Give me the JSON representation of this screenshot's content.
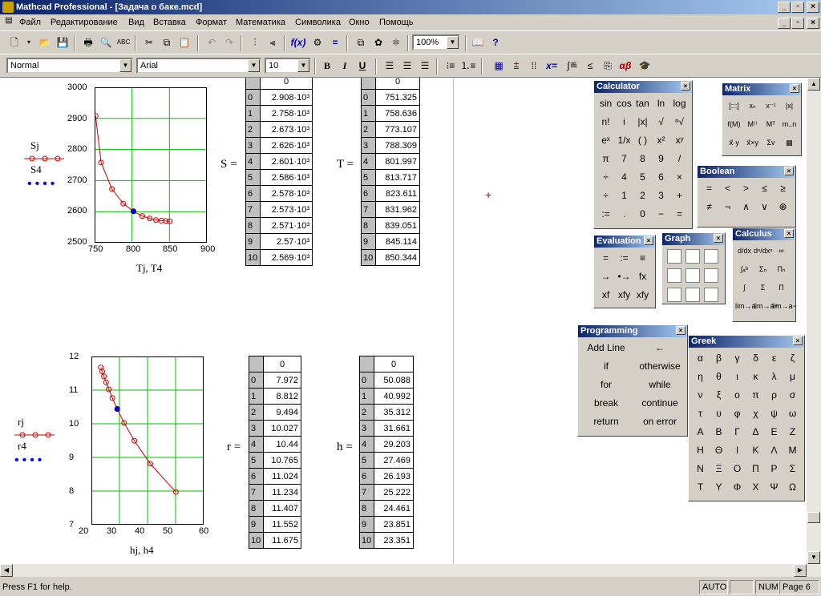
{
  "window": {
    "title": "Mathcad Professional - [Задача о баке.mcd]"
  },
  "menu": [
    "Файл",
    "Редактирование",
    "Вид",
    "Вставка",
    "Формат",
    "Математика",
    "Символика",
    "Окно",
    "Помощь"
  ],
  "toolbar": {
    "zoom": "100%"
  },
  "format_bar": {
    "style": "Normal",
    "font": "Arial",
    "size": "10"
  },
  "status": {
    "help": "Press F1 for help.",
    "mode": "AUTO",
    "num": "NUM",
    "page": "Page 6"
  },
  "plot1": {
    "legend": [
      "Sj",
      "S4"
    ],
    "xlabel": "Tj, T4",
    "xticks": [
      "750",
      "800",
      "850",
      "900"
    ],
    "yticks": [
      "3000",
      "2900",
      "2800",
      "2700",
      "2600",
      "2500"
    ]
  },
  "plot2": {
    "legend": [
      "rj",
      "r4"
    ],
    "xlabel": "hj, h4",
    "xticks": [
      "20",
      "30",
      "40",
      "50",
      "60"
    ],
    "yticks": [
      "12",
      "11",
      "10",
      "9",
      "8",
      "7"
    ]
  },
  "chart_data": [
    {
      "type": "line",
      "title": "",
      "xlabel": "Tj, T4",
      "ylabel": "",
      "xlim": [
        750,
        900
      ],
      "ylim": [
        2500,
        3000
      ],
      "series": [
        {
          "name": "Sj",
          "x": [
            751.325,
            758.636,
            773.107,
            788.309,
            801.997,
            813.717,
            823.611,
            831.962,
            839.051,
            845.114,
            850.344
          ],
          "y": [
            2908,
            2758,
            2673,
            2626,
            2601,
            2586,
            2578,
            2573,
            2571,
            2570,
            2569
          ]
        },
        {
          "name": "S4",
          "x": [
            801.997
          ],
          "y": [
            2601
          ]
        }
      ]
    },
    {
      "type": "line",
      "title": "",
      "xlabel": "hj, h4",
      "ylabel": "",
      "xlim": [
        20,
        60
      ],
      "ylim": [
        7,
        12
      ],
      "series": [
        {
          "name": "rj",
          "x": [
            50.088,
            40.992,
            35.312,
            31.661,
            29.203,
            27.469,
            26.193,
            25.222,
            24.461,
            23.851,
            23.351
          ],
          "y": [
            7.972,
            8.812,
            9.494,
            10.027,
            10.44,
            10.765,
            11.024,
            11.234,
            11.407,
            11.552,
            11.675
          ]
        },
        {
          "name": "r4",
          "x": [
            29.203
          ],
          "y": [
            10.44
          ]
        }
      ]
    }
  ],
  "tables": {
    "S": {
      "label": "S =",
      "header": "0",
      "rows": [
        "2.908·10³",
        "2.758·10³",
        "2.673·10³",
        "2.626·10³",
        "2.601·10³",
        "2.586·10³",
        "2.578·10³",
        "2.573·10³",
        "2.571·10³",
        "2.57·10³",
        "2.569·10³"
      ]
    },
    "T": {
      "label": "T =",
      "header": "0",
      "rows": [
        "751.325",
        "758.636",
        "773.107",
        "788.309",
        "801.997",
        "813.717",
        "823.611",
        "831.962",
        "839.051",
        "845.114",
        "850.344"
      ]
    },
    "r": {
      "label": "r =",
      "header": "0",
      "rows": [
        "7.972",
        "8.812",
        "9.494",
        "10.027",
        "10.44",
        "10.765",
        "11.024",
        "11.234",
        "11.407",
        "11.552",
        "11.675"
      ]
    },
    "h": {
      "label": "h =",
      "header": "0",
      "rows": [
        "50.088",
        "40.992",
        "35.312",
        "31.661",
        "29.203",
        "27.469",
        "26.193",
        "25.222",
        "24.461",
        "23.851",
        "23.351"
      ]
    }
  },
  "palettes": {
    "calculator": {
      "title": "Calculator",
      "keys": [
        "sin",
        "cos",
        "tan",
        "ln",
        "log",
        "n!",
        "i",
        "|x|",
        "√",
        "ⁿ√",
        "eˣ",
        "1/x",
        "( )",
        "x²",
        "xʸ",
        "π",
        "7",
        "8",
        "9",
        "/",
        "÷",
        "4",
        "5",
        "6",
        "×",
        "÷",
        "1",
        "2",
        "3",
        "+",
        ":=",
        ".",
        "0",
        "−",
        "="
      ]
    },
    "matrix": {
      "title": "Matrix",
      "keys": [
        "[:::]",
        "xₙ",
        "x⁻¹",
        "|x|",
        "f(M)",
        "M⁽⁾",
        "Mᵀ",
        "m..n",
        "x⃗·y",
        "x⃗×y",
        "Σv",
        "▦"
      ]
    },
    "boolean": {
      "title": "Boolean",
      "keys": [
        "=",
        "<",
        ">",
        "≤",
        "≥",
        "≠",
        "¬",
        "∧",
        "∨",
        "⊕"
      ]
    },
    "evaluation": {
      "title": "Evaluation",
      "keys": [
        "=",
        ":=",
        "≡",
        "→",
        "•→",
        "fx",
        "xf",
        "xfy",
        "xfy"
      ]
    },
    "graph": {
      "title": "Graph"
    },
    "calculus": {
      "title": "Calculus",
      "keys": [
        "d/dx",
        "dⁿ/dxⁿ",
        "∞",
        "∫ₐᵇ",
        "Σₙ",
        "Πₙ",
        "∫",
        "Σ",
        "Π",
        "lim→a",
        "lim→a+",
        "lim→a−"
      ]
    },
    "programming": {
      "title": "Programming",
      "keys": [
        "Add Line",
        "←",
        "if",
        "otherwise",
        "for",
        "while",
        "break",
        "continue",
        "return",
        "on error"
      ]
    },
    "greek": {
      "title": "Greek",
      "keys": [
        "α",
        "β",
        "γ",
        "δ",
        "ε",
        "ζ",
        "η",
        "θ",
        "ι",
        "κ",
        "λ",
        "μ",
        "ν",
        "ξ",
        "ο",
        "π",
        "ρ",
        "σ",
        "τ",
        "υ",
        "φ",
        "χ",
        "ψ",
        "ω",
        "Α",
        "Β",
        "Γ",
        "Δ",
        "Ε",
        "Ζ",
        "Η",
        "Θ",
        "Ι",
        "Κ",
        "Λ",
        "Μ",
        "Ν",
        "Ξ",
        "Ο",
        "Π",
        "Ρ",
        "Σ",
        "Τ",
        "Υ",
        "Φ",
        "Χ",
        "Ψ",
        "Ω"
      ]
    }
  }
}
